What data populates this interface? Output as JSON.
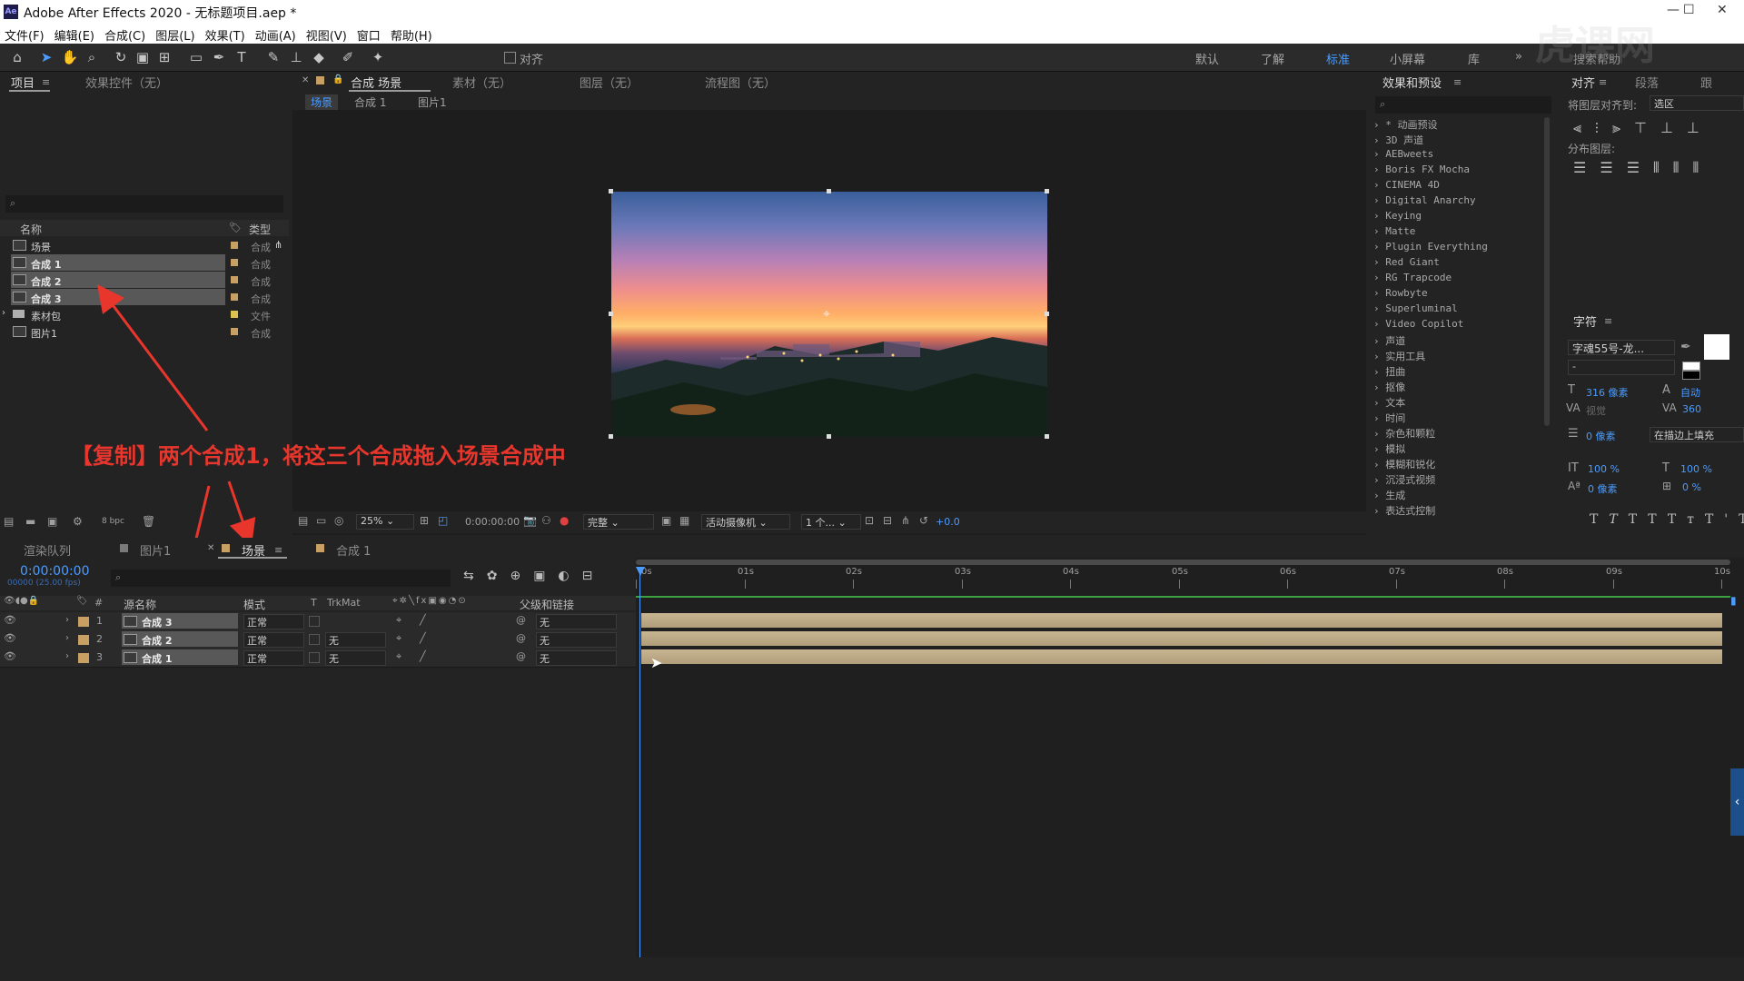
{
  "window": {
    "title": "Adobe After Effects 2020 - 无标题项目.aep *",
    "logo": "Ae"
  },
  "menu": [
    "文件(F)",
    "编辑(E)",
    "合成(C)",
    "图层(L)",
    "效果(T)",
    "动画(A)",
    "视图(V)",
    "窗口",
    "帮助(H)"
  ],
  "toolbar": {
    "align_label": "对齐",
    "workspaces": [
      "默认",
      "了解",
      "标准",
      "小屏幕",
      "库"
    ],
    "active_workspace": "标准",
    "search_help": "搜索帮助"
  },
  "project_panel": {
    "tabs": [
      "项目",
      "效果控件（无）"
    ],
    "columns": {
      "name": "名称",
      "type": "类型"
    },
    "items": [
      {
        "name": "场景",
        "type": "合成",
        "icon": "comp-icon",
        "label_color": "#c8a064",
        "selected": false
      },
      {
        "name": "合成 1",
        "type": "合成",
        "icon": "comp-icon",
        "label_color": "#c8a064",
        "selected": true
      },
      {
        "name": "合成 2",
        "type": "合成",
        "icon": "comp-icon",
        "label_color": "#c8a064",
        "selected": true
      },
      {
        "name": "合成 3",
        "type": "合成",
        "icon": "comp-icon",
        "label_color": "#c8a064",
        "selected": true
      },
      {
        "name": "素材包",
        "type": "文件",
        "icon": "folder-icon",
        "label_color": "#e0c050",
        "selected": false
      },
      {
        "name": "图片1",
        "type": "合成",
        "icon": "comp-icon",
        "label_color": "#c8a064",
        "selected": false
      }
    ],
    "bpc": "8 bpc"
  },
  "viewer": {
    "tabs": [
      "合成 场景",
      "素材（无）",
      "图层（无）",
      "流程图（无）"
    ],
    "breadcrumbs": [
      "场景",
      "合成 1",
      "图片1"
    ],
    "zoom": "25%",
    "timecode": "0:00:00:00",
    "quality": "完整",
    "camera": "活动摄像机",
    "views": "1 个...",
    "exposure": "+0.0"
  },
  "effects_panel": {
    "title": "效果和预设",
    "items": [
      "* 动画预设",
      "3D 声道",
      "AEBweets",
      "Boris FX Mocha",
      "CINEMA 4D",
      "Digital Anarchy",
      "Keying",
      "Matte",
      "Plugin Everything",
      "Red Giant",
      "RG Trapcode",
      "Rowbyte",
      "Superluminal",
      "Video Copilot",
      "声道",
      "实用工具",
      "扭曲",
      "抠像",
      "文本",
      "时间",
      "杂色和颗粒",
      "模拟",
      "模糊和锐化",
      "沉浸式视频",
      "生成",
      "表达式控制"
    ]
  },
  "align_panel": {
    "tabs": [
      "对齐",
      "段落",
      "跟"
    ],
    "align_to_label": "将图层对齐到:",
    "align_to_value": "选区",
    "distribute_label": "分布图层:"
  },
  "character_panel": {
    "title": "字符",
    "font": "字魂55号-龙...",
    "style": "-",
    "size": "316 像素",
    "leading": "自动",
    "kerning": "视觉",
    "tracking": "360",
    "stroke": "0 像素",
    "stroke_mode": "在描边上填充",
    "vscale": "100 %",
    "hscale": "100 %",
    "baseline": "0 像素",
    "tsume": "0 %"
  },
  "timeline": {
    "tabs": [
      "渲染队列",
      "图片1",
      "场景",
      "合成 1"
    ],
    "active_tab": "场景",
    "timecode": "0:00:00:00",
    "fps": "00000 (25.00 fps)",
    "columns": {
      "num": "#",
      "source": "源名称",
      "mode": "模式",
      "t": "T",
      "trkmat": "TrkMat",
      "parent": "父级和链接"
    },
    "layers": [
      {
        "num": "1",
        "name": "合成 3",
        "mode": "正常",
        "trkmat": "",
        "parent": "无"
      },
      {
        "num": "2",
        "name": "合成 2",
        "mode": "正常",
        "trkmat": "无",
        "parent": "无"
      },
      {
        "num": "3",
        "name": "合成 1",
        "mode": "正常",
        "trkmat": "无",
        "parent": "无"
      }
    ],
    "ruler": [
      "0s",
      "01s",
      "02s",
      "03s",
      "04s",
      "05s",
      "06s",
      "07s",
      "08s",
      "09s",
      "10s"
    ]
  },
  "annotation": {
    "text": "【复制】两个合成1，将这三个合成拖入场景合成中",
    "color": "#e8362c"
  },
  "watermark": "虎课网"
}
